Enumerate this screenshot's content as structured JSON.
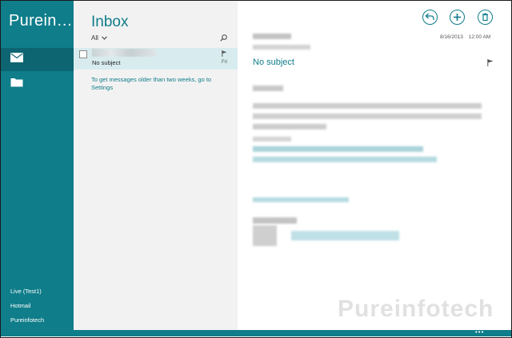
{
  "app": {
    "title": "Purein…"
  },
  "sidebar": {
    "nav": [
      {
        "icon": "mail-icon",
        "label": ""
      },
      {
        "icon": "folder-icon",
        "label": ""
      }
    ],
    "accounts": [
      "Live (Test1)",
      "Hotmail",
      "Pureinfotech"
    ]
  },
  "list": {
    "title": "Inbox",
    "filter": "All",
    "messages": [
      {
        "subject": "No subject",
        "date": "Fri"
      }
    ],
    "older_link": "To get messages older than two weeks, go to Settings"
  },
  "reading": {
    "date": "8/16/2013",
    "time": "12:00 AM",
    "subject": "No subject"
  },
  "watermark": "Pureinfotech",
  "colors": {
    "accent": "#0f7d8a",
    "sidebar": "#0f7d8a",
    "selected_row": "#d8ecef"
  }
}
